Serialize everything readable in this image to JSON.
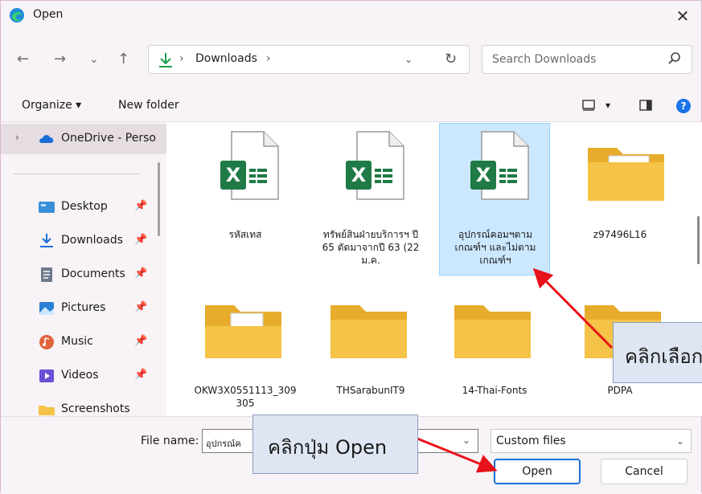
{
  "window": {
    "title": "Open",
    "close_glyph": "✕"
  },
  "nav": {
    "back_glyph": "←",
    "forward_glyph": "→",
    "recent_glyph": "⌄",
    "up_glyph": "↑",
    "address": {
      "separator": "›",
      "current": "Downloads",
      "trailing_separator": "›",
      "dropdown_glyph": "⌄",
      "refresh_glyph": "↻"
    },
    "search": {
      "placeholder": "Search Downloads"
    }
  },
  "toolbar": {
    "organize_label": "Organize ▾",
    "new_folder_label": "New folder",
    "view_dropdown_glyph": "▾",
    "help_glyph": "?"
  },
  "sidebar": {
    "onedrive": {
      "label": "OneDrive - Perso",
      "chevron": "›"
    },
    "items": [
      {
        "label": "Desktop",
        "icon": "desktop-icon",
        "pin": "📌"
      },
      {
        "label": "Downloads",
        "icon": "download-icon",
        "pin": "📌"
      },
      {
        "label": "Documents",
        "icon": "document-icon",
        "pin": "📌"
      },
      {
        "label": "Pictures",
        "icon": "pictures-icon",
        "pin": "📌"
      },
      {
        "label": "Music",
        "icon": "music-icon",
        "pin": "📌"
      },
      {
        "label": "Videos",
        "icon": "videos-icon",
        "pin": "📌"
      },
      {
        "label": "Screenshots",
        "icon": "folder-icon",
        "pin": ""
      }
    ]
  },
  "files": [
    {
      "name": "รหัสเทส",
      "type": "excel",
      "selected": false
    },
    {
      "name": "ทรัพย์สินฝ่ายบริการฯ ปี 65 ตัดมาจากปี 63 (22 ม.ค.",
      "type": "excel",
      "selected": false
    },
    {
      "name": "อุปกรณ์คอมฯตามเกณฑ์ฯ และไม่ตามเกณฑ์ฯ",
      "type": "excel",
      "selected": true
    },
    {
      "name": "z97496L16",
      "type": "folder-doc",
      "selected": false
    },
    {
      "name": "OKW3X0551113_309305",
      "type": "folder-doc",
      "selected": false
    },
    {
      "name": "THSarabunIT9",
      "type": "folder",
      "selected": false
    },
    {
      "name": "14-Thai-Fonts",
      "type": "folder",
      "selected": false
    },
    {
      "name": "PDPA",
      "type": "folder",
      "selected": false
    }
  ],
  "bottom": {
    "file_name_label": "File name:",
    "file_name_value": "อุปกรณ์ค",
    "file_name_dropdown": "⌄",
    "file_type_value": "Custom files",
    "file_type_dropdown": "⌄",
    "open_label": "Open",
    "cancel_label": "Cancel"
  },
  "annotations": {
    "select_callout": "คลิกเลือกไฟล์",
    "open_callout": "คลิกปุ่ม Open",
    "arrow_color": "#e8121a"
  },
  "colors": {
    "excel_green": "#1f7a45",
    "folder_yellow": "#f5c348",
    "selection_blue": "#cce8ff",
    "accent_blue": "#1a6ed8"
  }
}
